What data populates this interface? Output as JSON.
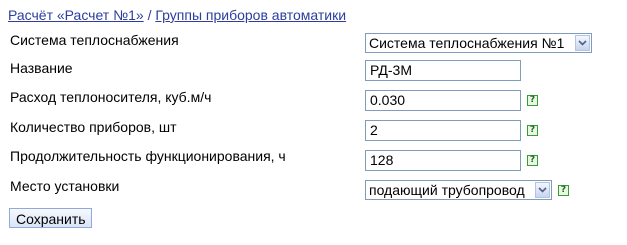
{
  "breadcrumb": {
    "link1": "Расчёт «Расчет №1»",
    "separator": "/",
    "link2": "Группы приборов автоматики"
  },
  "form": {
    "heating_system": {
      "label": "Система теплоснабжения",
      "value": "Система теплоснабжения №1"
    },
    "name": {
      "label": "Название",
      "value": "РД-3М"
    },
    "coolant_flow": {
      "label": "Расход теплоносителя, куб.м/ч",
      "value": "0.030"
    },
    "device_count": {
      "label": "Количество приборов, шт",
      "value": "2"
    },
    "operation_duration": {
      "label": "Продолжительность функционирования, ч",
      "value": "128"
    },
    "installation_place": {
      "label": "Место установки",
      "value": "подающий трубопровод"
    }
  },
  "icons": {
    "help": "?",
    "dropdown": "chevron-down-icon"
  },
  "actions": {
    "save_label": "Сохранить"
  }
}
